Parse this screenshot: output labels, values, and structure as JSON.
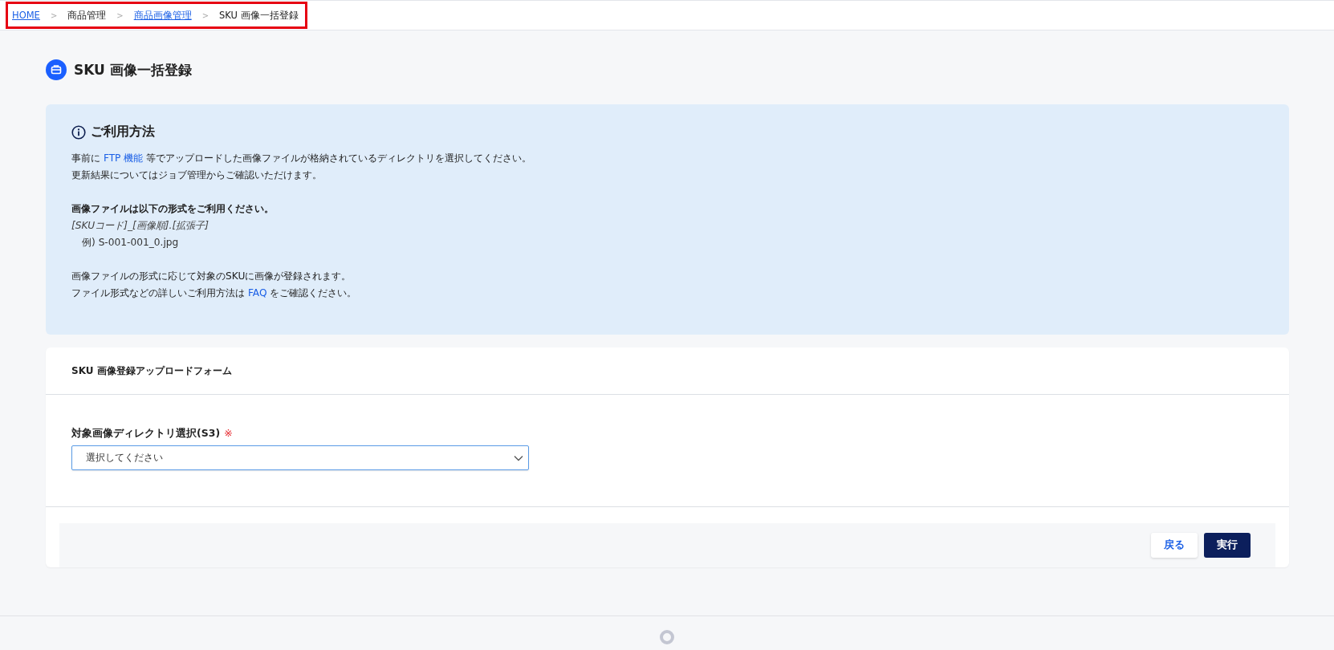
{
  "breadcrumb": [
    {
      "label": "HOME",
      "kind": "link"
    },
    {
      "label": "商品管理",
      "kind": "text",
      "separator": ">"
    },
    {
      "label": "商品画像管理",
      "kind": "link",
      "separator": ">"
    },
    {
      "label": "SKU 画像一括登録",
      "kind": "text",
      "separator": ">"
    }
  ],
  "page_title": "SKU 画像一括登録",
  "info": {
    "heading": "ご利用方法",
    "paragraphs": [
      [
        {
          "kind": "plain",
          "segments": [
            {
              "text": "事前に "
            },
            {
              "text": "FTP 機能",
              "kind": "link"
            },
            {
              "text": " 等でアップロードした画像ファイルが格納されているディレクトリを選択してください。"
            }
          ]
        },
        {
          "kind": "plain",
          "segments": [
            {
              "text": "更新結果についてはジョブ管理からご確認いただけます。"
            }
          ]
        }
      ],
      [
        {
          "kind": "bold",
          "segments": [
            {
              "text": "画像ファイルは以下の形式をご利用ください。"
            }
          ]
        },
        {
          "kind": "italic",
          "segments": [
            {
              "text": "[SKUコード]_[画像順].[拡張子]"
            }
          ]
        },
        {
          "kind": "indent",
          "segments": [
            {
              "text": "例) S-001-001_0.jpg"
            }
          ]
        }
      ],
      [
        {
          "kind": "plain",
          "segments": [
            {
              "text": "画像ファイルの形式に応じて対象のSKUに画像が登録されます。"
            }
          ]
        },
        {
          "kind": "plain",
          "segments": [
            {
              "text": "ファイル形式などの詳しいご利用方法は "
            },
            {
              "text": "FAQ",
              "kind": "link"
            },
            {
              "text": " をご確認ください。"
            }
          ]
        }
      ]
    ]
  },
  "form": {
    "title": "SKU 画像登録アップロードフォーム",
    "field": {
      "label": "対象画像ディレクトリ選択(S3)",
      "required_mark": "※",
      "value": "選択してください"
    },
    "buttons": [
      {
        "label": "戻る",
        "kind": "secondary"
      },
      {
        "label": "実行",
        "kind": "primary"
      }
    ]
  }
}
